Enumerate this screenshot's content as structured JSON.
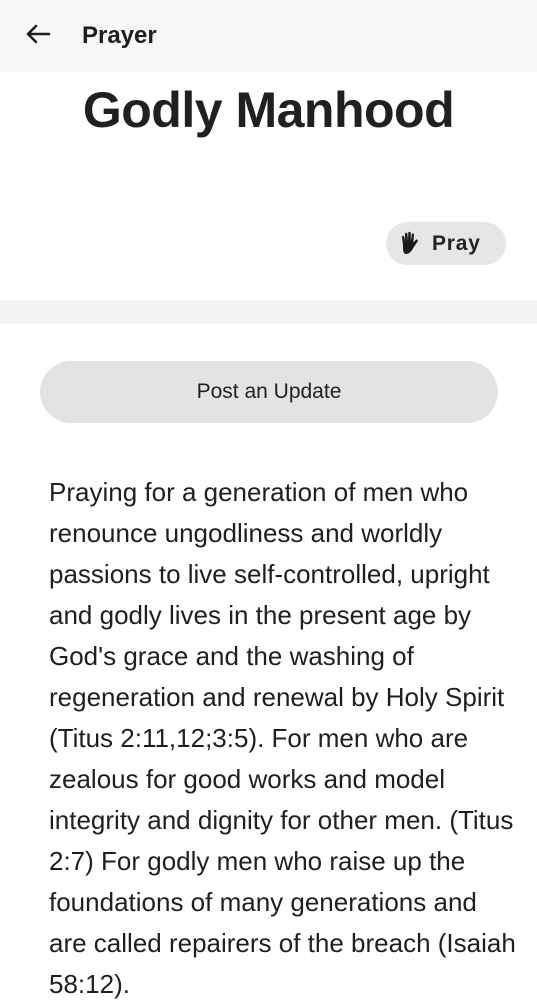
{
  "header": {
    "title": "Prayer",
    "back_icon": "arrow-left-icon"
  },
  "prayer": {
    "title": "Godly Manhood",
    "pray_label": "Pray",
    "pray_icon": "praying-hand-icon",
    "update_label": "Post an Update",
    "text": "Praying for a generation of men who renounce ungodliness and worldly passions to live self-controlled, upright and godly lives in the present age by God's grace and the washing of regeneration and renewal by Holy Spirit (Titus 2:11,12;3:5). For men who are zealous for good works and model integrity and dignity for other men. (Titus 2:7) For godly men who raise up the foundations of many generations and are called repairers of the breach (Isaiah 58:12)."
  }
}
